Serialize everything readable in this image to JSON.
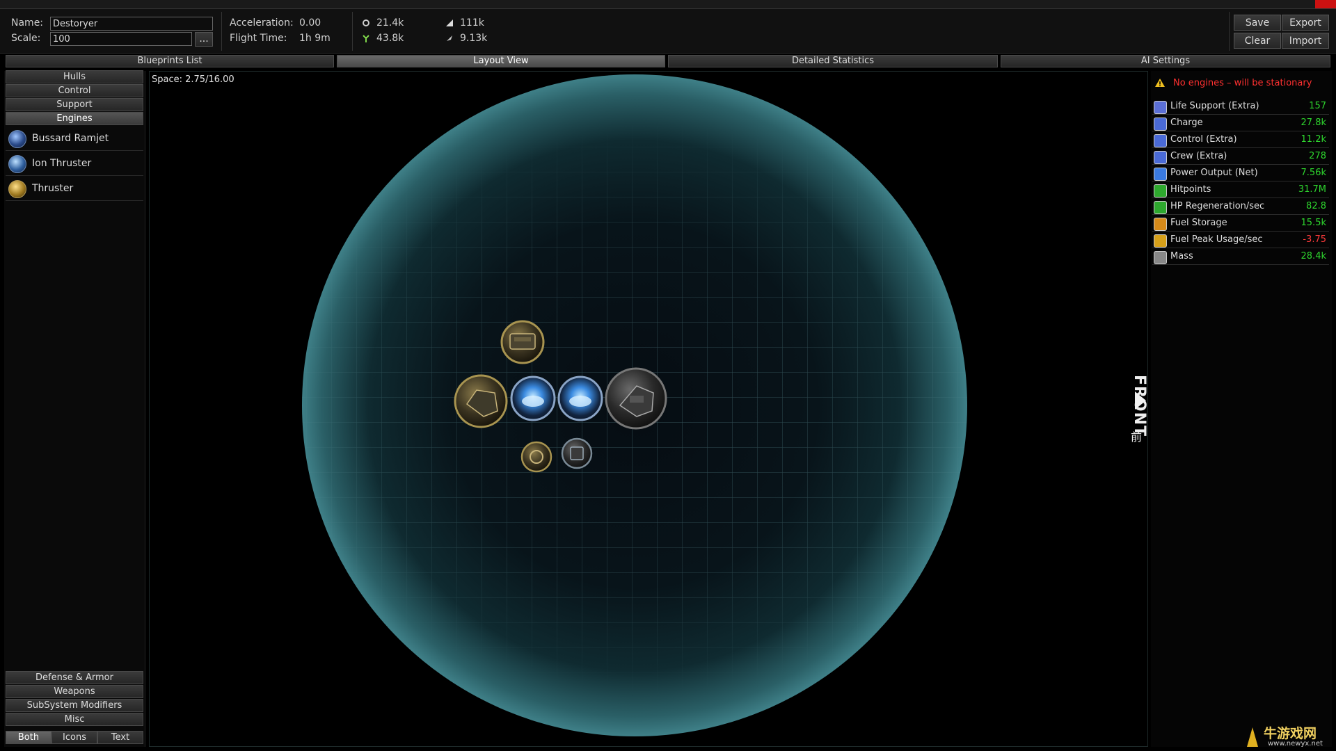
{
  "header": {
    "name_label": "Name:",
    "name_value": "Destoryer",
    "scale_label": "Scale:",
    "scale_value": "100",
    "scale_button": "...",
    "acceleration_label": "Acceleration:",
    "acceleration_value": "0.00",
    "flight_time_label": "Flight Time:",
    "flight_time_value": "1h 9m",
    "resources": [
      {
        "icon": "gear-icon",
        "value": "21.4k"
      },
      {
        "icon": "flask-icon",
        "value": "111k"
      },
      {
        "icon": "plant-icon",
        "value": "43.8k"
      },
      {
        "icon": "rocket-icon",
        "value": "9.13k"
      }
    ],
    "buttons": {
      "save": "Save",
      "export": "Export",
      "clear": "Clear",
      "import": "Import"
    }
  },
  "tabs": [
    {
      "label": "Blueprints List",
      "active": false
    },
    {
      "label": "Layout View",
      "active": true
    },
    {
      "label": "Detailed Statistics",
      "active": false
    },
    {
      "label": "AI Settings",
      "active": false
    }
  ],
  "sidebar": {
    "categories_top": [
      "Hulls",
      "Control",
      "Support",
      "Engines"
    ],
    "selected_category": "Engines",
    "engines": [
      {
        "label": "Bussard Ramjet",
        "icon": "bussard-ramjet-icon"
      },
      {
        "label": "Ion Thruster",
        "icon": "ion-thruster-icon"
      },
      {
        "label": "Thruster",
        "icon": "thruster-icon"
      }
    ],
    "categories_bottom": [
      "Defense & Armor",
      "Weapons",
      "SubSystem Modifiers",
      "Misc"
    ],
    "view_modes": [
      {
        "label": "Both",
        "selected": true
      },
      {
        "label": "Icons",
        "selected": false
      },
      {
        "label": "Text",
        "selected": false
      }
    ]
  },
  "layout": {
    "space_label": "Space: 2.75/16.00",
    "front_label": "FRONT",
    "front_kanji": "前"
  },
  "warning": {
    "text": "No engines – will be stationary",
    "icon": "warning-icon"
  },
  "stats": [
    {
      "name": "Life Support (Extra)",
      "value": "157",
      "icon": "life-support-icon",
      "color": "#5b6fd6",
      "negative": false
    },
    {
      "name": "Charge",
      "value": "27.8k",
      "icon": "battery-icon",
      "color": "#4a6ad6",
      "negative": false
    },
    {
      "name": "Control (Extra)",
      "value": "11.2k",
      "icon": "control-icon",
      "color": "#4a6ad6",
      "negative": false
    },
    {
      "name": "Crew (Extra)",
      "value": "278",
      "icon": "crew-icon",
      "color": "#4a6ad6",
      "negative": false
    },
    {
      "name": "Power Output (Net)",
      "value": "7.56k",
      "icon": "power-icon",
      "color": "#3a7ae0",
      "negative": false
    },
    {
      "name": "Hitpoints",
      "value": "31.7M",
      "icon": "hitpoints-icon",
      "color": "#2ea82e",
      "negative": false
    },
    {
      "name": "HP Regeneration/sec",
      "value": "82.8",
      "icon": "regen-icon",
      "color": "#2ea82e",
      "negative": false
    },
    {
      "name": "Fuel Storage",
      "value": "15.5k",
      "icon": "fuel-icon",
      "color": "#d68a1a",
      "negative": false
    },
    {
      "name": "Fuel Peak Usage/sec",
      "value": "-3.75",
      "icon": "fuel-usage-icon",
      "color": "#d6a01a",
      "negative": true
    },
    {
      "name": "Mass",
      "value": "28.4k",
      "icon": "mass-icon",
      "color": "#888888",
      "negative": false
    }
  ],
  "watermark": {
    "text": "牛游戏网",
    "subtext": "www.newyx.net"
  }
}
